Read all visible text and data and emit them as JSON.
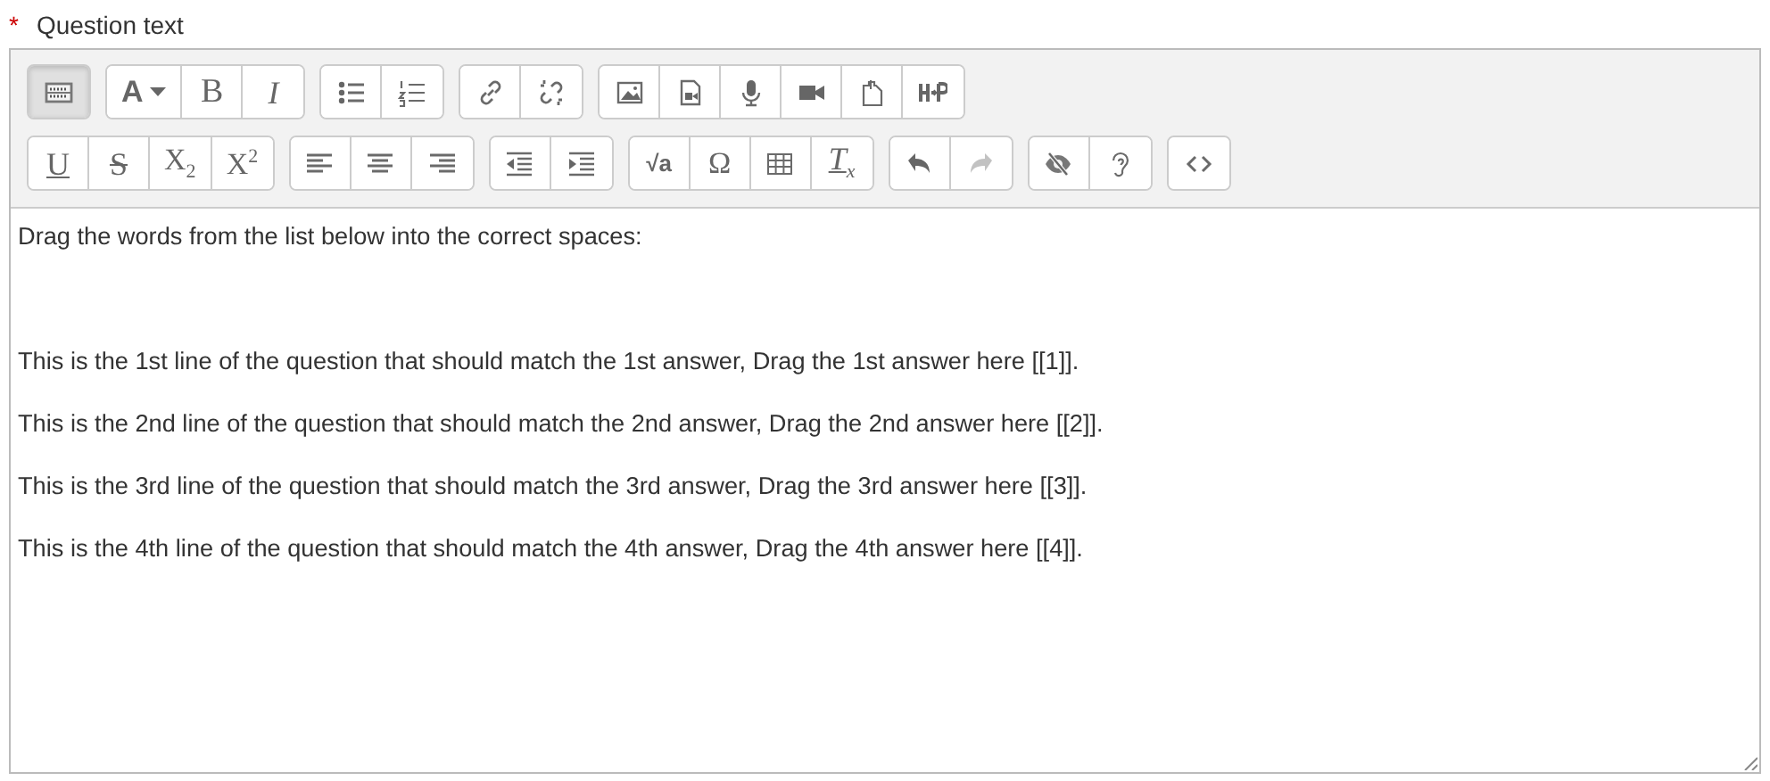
{
  "field": {
    "label": "Question text",
    "required": true,
    "required_mark": "*"
  },
  "toolbar": {
    "rows": [
      [
        [
          {
            "kind": "toolbar-toggle",
            "pressed": true,
            "disabled": false
          }
        ],
        [
          {
            "kind": "font-color",
            "text": "A",
            "pressed": false,
            "disabled": false
          },
          {
            "kind": "bold",
            "text": "B",
            "pressed": false,
            "disabled": false
          },
          {
            "kind": "italic",
            "text": "I",
            "pressed": false,
            "disabled": false
          }
        ],
        [
          {
            "kind": "bullet-list",
            "pressed": false,
            "disabled": false
          },
          {
            "kind": "numbered-list",
            "pressed": false,
            "disabled": false
          }
        ],
        [
          {
            "kind": "link",
            "pressed": false,
            "disabled": false
          },
          {
            "kind": "unlink",
            "pressed": false,
            "disabled": false
          }
        ],
        [
          {
            "kind": "image",
            "pressed": false,
            "disabled": false
          },
          {
            "kind": "media",
            "pressed": false,
            "disabled": false
          },
          {
            "kind": "microphone",
            "pressed": false,
            "disabled": false
          },
          {
            "kind": "video",
            "pressed": false,
            "disabled": false
          },
          {
            "kind": "file",
            "pressed": false,
            "disabled": false
          },
          {
            "kind": "h5p",
            "pressed": false,
            "disabled": false
          }
        ]
      ],
      [
        [
          {
            "kind": "underline",
            "text": "U",
            "pressed": false,
            "disabled": false
          },
          {
            "kind": "strike",
            "text": "S",
            "pressed": false,
            "disabled": false
          },
          {
            "kind": "subscript",
            "text": "X$_{2}$",
            "pressed": false,
            "disabled": false
          },
          {
            "kind": "superscript",
            "text": "X$^{2}$",
            "pressed": false,
            "disabled": false
          }
        ],
        [
          {
            "kind": "align-left",
            "pressed": false,
            "disabled": false
          },
          {
            "kind": "align-center",
            "pressed": false,
            "disabled": false
          },
          {
            "kind": "align-right",
            "pressed": false,
            "disabled": false
          }
        ],
        [
          {
            "kind": "outdent",
            "pressed": false,
            "disabled": false
          },
          {
            "kind": "indent",
            "pressed": false,
            "disabled": false
          }
        ],
        [
          {
            "kind": "equation",
            "text": "√a",
            "pressed": false,
            "disabled": false
          },
          {
            "kind": "symbol",
            "text": "Ω",
            "pressed": false,
            "disabled": false
          },
          {
            "kind": "table",
            "pressed": false,
            "disabled": false
          },
          {
            "kind": "clear-format",
            "text": "T$_{x}$",
            "pressed": false,
            "disabled": false
          }
        ],
        [
          {
            "kind": "undo",
            "pressed": false,
            "disabled": false
          },
          {
            "kind": "redo",
            "pressed": false,
            "disabled": true
          }
        ],
        [
          {
            "kind": "hidden",
            "pressed": false,
            "disabled": false
          },
          {
            "kind": "accessibility",
            "pressed": false,
            "disabled": false
          }
        ],
        [
          {
            "kind": "code",
            "pressed": false,
            "disabled": false
          }
        ]
      ]
    ]
  },
  "content": {
    "intro": "Drag the words from the list below into the correct spaces:",
    "lines": [
      "This is the 1st line of the question that should match the 1st answer, Drag the 1st answer here [[1]].",
      "This is the 2nd line of the question that should match the 2nd answer, Drag the 2nd answer here [[2]].",
      "This is the 3rd line of the question that should match the 3rd answer, Drag the 3rd answer here [[3]].",
      "This is the 4th line of the question that should match the 4th answer, Drag the 4th answer here [[4]]."
    ]
  }
}
